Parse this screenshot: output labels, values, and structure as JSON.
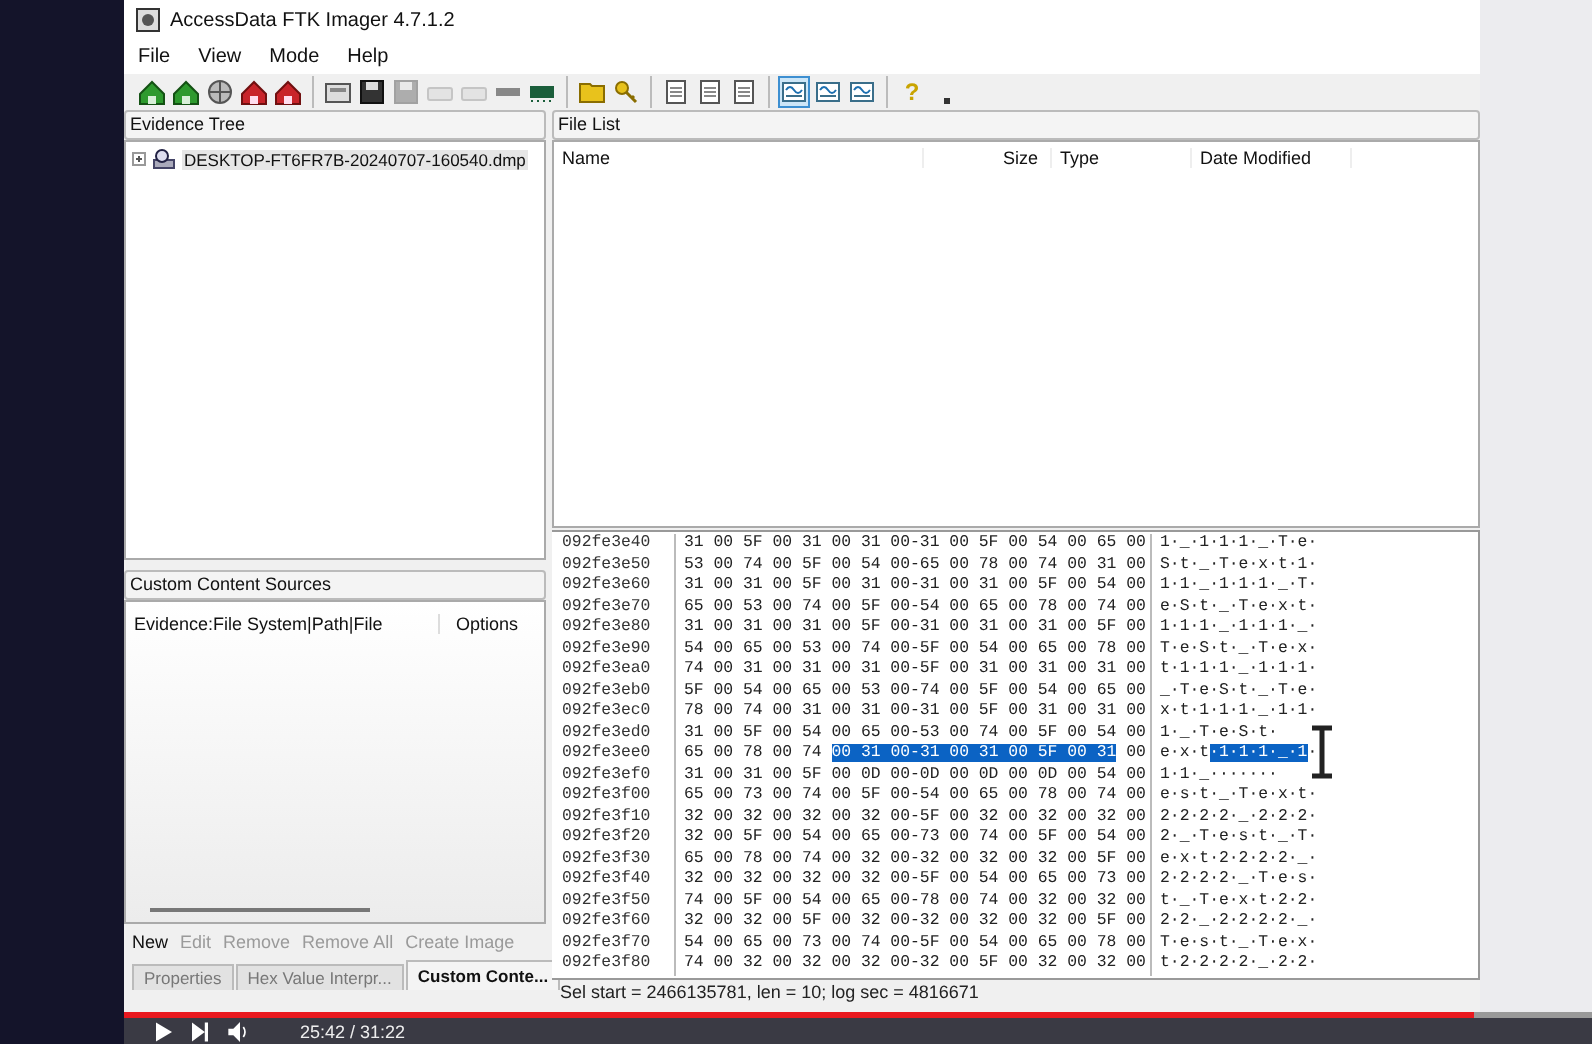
{
  "window": {
    "title": "AccessData FTK Imager 4.7.1.2"
  },
  "menu": [
    {
      "label": "File"
    },
    {
      "label": "View"
    },
    {
      "label": "Mode"
    },
    {
      "label": "Help"
    }
  ],
  "toolbar": [
    [
      {
        "kind": "add",
        "disabled": false,
        "selected": false
      },
      {
        "kind": "add",
        "disabled": false,
        "selected": false
      },
      {
        "kind": "globe",
        "disabled": false,
        "selected": false
      },
      {
        "kind": "remove",
        "disabled": false,
        "selected": false
      },
      {
        "kind": "remove",
        "disabled": false,
        "selected": false
      }
    ],
    [
      {
        "kind": "disk",
        "disabled": false,
        "selected": false
      },
      {
        "kind": "save",
        "disabled": false,
        "selected": false
      },
      {
        "kind": "save",
        "disabled": true,
        "selected": false
      },
      {
        "kind": "drive",
        "disabled": true,
        "selected": false
      },
      {
        "kind": "drive",
        "disabled": true,
        "selected": false
      },
      {
        "kind": "bar",
        "disabled": false,
        "selected": false
      },
      {
        "kind": "memory",
        "disabled": false,
        "selected": false
      }
    ],
    [
      {
        "kind": "folder",
        "disabled": false,
        "selected": false
      },
      {
        "kind": "key",
        "disabled": false,
        "selected": false
      }
    ],
    [
      {
        "kind": "page",
        "disabled": false,
        "selected": false
      },
      {
        "kind": "page",
        "disabled": false,
        "selected": false
      },
      {
        "kind": "page",
        "disabled": false,
        "selected": false
      }
    ],
    [
      {
        "kind": "hex",
        "disabled": false,
        "selected": true
      },
      {
        "kind": "hex",
        "disabled": false,
        "selected": false
      },
      {
        "kind": "hex",
        "disabled": false,
        "selected": false
      }
    ],
    [
      {
        "kind": "help",
        "label": "?",
        "disabled": false,
        "selected": false
      },
      {
        "kind": "more",
        "disabled": false,
        "selected": false
      }
    ]
  ],
  "evidence_tree": {
    "title": "Evidence Tree",
    "items": [
      {
        "label": "DESKTOP-FT6FR7B-20240707-160540.dmp",
        "selected": true,
        "expanded": false
      }
    ]
  },
  "custom_content_sources": {
    "title": "Custom Content Sources",
    "columns": [
      "Evidence:File System|Path|File",
      "Options"
    ],
    "buttons": [
      {
        "label": "New",
        "disabled": false
      },
      {
        "label": "Edit",
        "disabled": true
      },
      {
        "label": "Remove",
        "disabled": true
      },
      {
        "label": "Remove All",
        "disabled": true
      },
      {
        "label": "Create Image",
        "disabled": true
      }
    ]
  },
  "bottom_tabs": [
    {
      "label": "Properties",
      "selected": false
    },
    {
      "label": "Hex Value Interpr...",
      "selected": false
    },
    {
      "label": "Custom Conte...",
      "selected": true
    }
  ],
  "file_list": {
    "title": "File List",
    "columns": [
      "Name",
      "Size",
      "Type",
      "Date Modified"
    ]
  },
  "hex_view": {
    "rows": [
      {
        "offset": "092fe3e40",
        "hex": "31 00 5F 00 31 00 31 00-31 00 5F 00 54 00 65 00",
        "ascii": "1·_·1·1·1·_·T·e·"
      },
      {
        "offset": "092fe3e50",
        "hex": "53 00 74 00 5F 00 54 00-65 00 78 00 74 00 31 00",
        "ascii": "S·t·_·T·e·x·t·1·"
      },
      {
        "offset": "092fe3e60",
        "hex": "31 00 31 00 5F 00 31 00-31 00 31 00 5F 00 54 00",
        "ascii": "1·1·_·1·1·1·_·T·"
      },
      {
        "offset": "092fe3e70",
        "hex": "65 00 53 00 74 00 5F 00-54 00 65 00 78 00 74 00",
        "ascii": "e·S·t·_·T·e·x·t·"
      },
      {
        "offset": "092fe3e80",
        "hex": "31 00 31 00 31 00 5F 00-31 00 31 00 31 00 5F 00",
        "ascii": "1·1·1·_·1·1·1·_·"
      },
      {
        "offset": "092fe3e90",
        "hex": "54 00 65 00 53 00 74 00-5F 00 54 00 65 00 78 00",
        "ascii": "T·e·S·t·_·T·e·x·"
      },
      {
        "offset": "092fe3ea0",
        "hex": "74 00 31 00 31 00 31 00-5F 00 31 00 31 00 31 00",
        "ascii": "t·1·1·1·_·1·1·1·"
      },
      {
        "offset": "092fe3eb0",
        "hex": "5F 00 54 00 65 00 53 00-74 00 5F 00 54 00 65 00",
        "ascii": "_·T·e·S·t·_·T·e·"
      },
      {
        "offset": "092fe3ec0",
        "hex": "78 00 74 00 31 00 31 00-31 00 5F 00 31 00 31 00",
        "ascii": "x·t·1·1·1·_·1·1·"
      },
      {
        "offset": "092fe3ed0",
        "hex": "31 00 5F 00 54 00 65 00-53 00 74 00 5F 00 54 00",
        "ascii": "1·_·T·e·S·t·"
      },
      {
        "offset": "092fe3ee0",
        "hex": "65 00 78 00 74",
        "hex_selected": "00 31 00-31 00 31 00 5F 00 31",
        "hex_after": "00",
        "ascii": "e·x·t",
        "ascii_selected": "·1·1·1·_·1",
        "ascii_after": "·"
      },
      {
        "offset": "092fe3ef0",
        "hex": "31 00 31 00 5F 00 0D 00-0D 00 0D 00 0D 00 54 00",
        "ascii": "1·1·_·······"
      },
      {
        "offset": "092fe3f00",
        "hex": "65 00 73 00 74 00 5F 00-54 00 65 00 78 00 74 00",
        "ascii": "e·s·t·_·T·e·x·t·"
      },
      {
        "offset": "092fe3f10",
        "hex": "32 00 32 00 32 00 32 00-5F 00 32 00 32 00 32 00",
        "ascii": "2·2·2·2·_·2·2·2·"
      },
      {
        "offset": "092fe3f20",
        "hex": "32 00 5F 00 54 00 65 00-73 00 74 00 5F 00 54 00",
        "ascii": "2·_·T·e·s·t·_·T·"
      },
      {
        "offset": "092fe3f30",
        "hex": "65 00 78 00 74 00 32 00-32 00 32 00 32 00 5F 00",
        "ascii": "e·x·t·2·2·2·2·_·"
      },
      {
        "offset": "092fe3f40",
        "hex": "32 00 32 00 32 00 32 00-5F 00 54 00 65 00 73 00",
        "ascii": "2·2·2·2·_·T·e·s·"
      },
      {
        "offset": "092fe3f50",
        "hex": "74 00 5F 00 54 00 65 00-78 00 74 00 32 00 32 00",
        "ascii": "t·_·T·e·x·t·2·2·"
      },
      {
        "offset": "092fe3f60",
        "hex": "32 00 32 00 5F 00 32 00-32 00 32 00 32 00 5F 00",
        "ascii": "2·2·_·2·2·2·2·_·"
      },
      {
        "offset": "092fe3f70",
        "hex": "54 00 65 00 73 00 74 00-5F 00 54 00 65 00 78 00",
        "ascii": "T·e·s·t·_·T·e·x·"
      },
      {
        "offset": "092fe3f80",
        "hex": "74 00 32 00 32 00 32 00-32 00 5F 00 32 00 32 00",
        "ascii": "t·2·2·2·2·_·2·2·"
      }
    ]
  },
  "status_bar": {
    "text": "Sel start = 2466135781, len = 10; log sec = 4816671"
  },
  "video_player": {
    "time": "25:42 / 31:22",
    "progress": {
      "level": 0.92
    }
  }
}
